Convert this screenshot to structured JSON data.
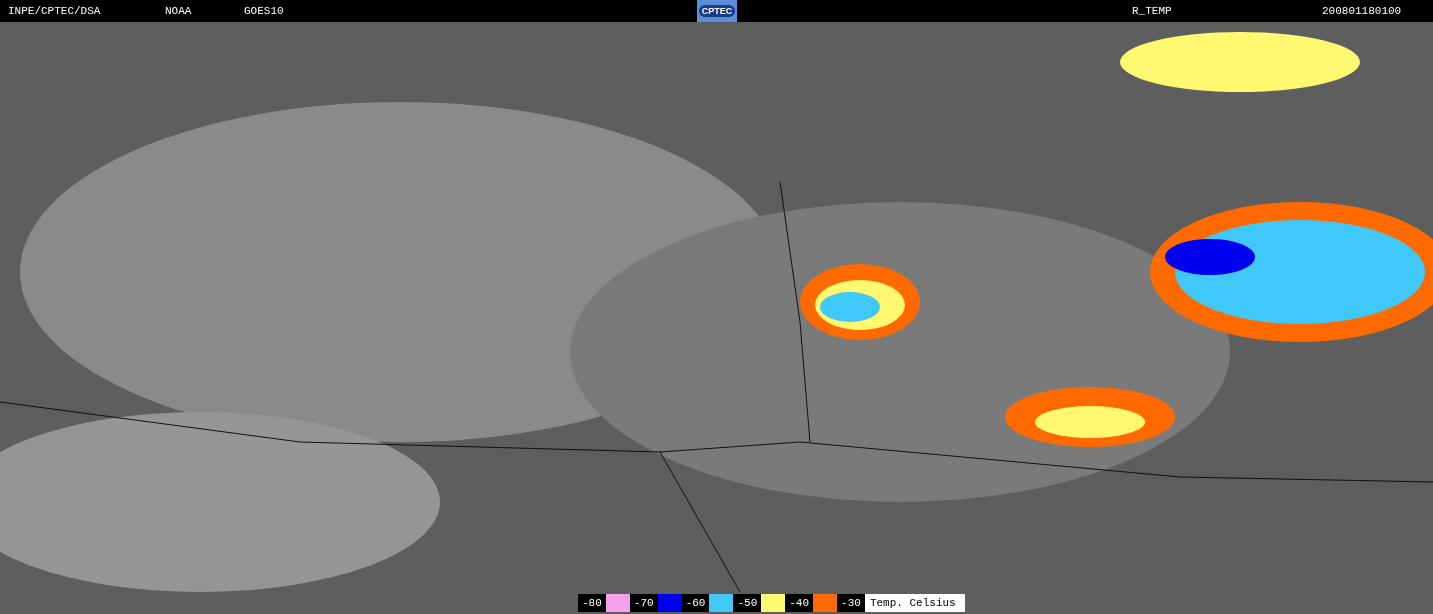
{
  "header": {
    "source": "INPE/CPTEC/DSA",
    "agency": "NOAA",
    "satellite": "GOES10",
    "logo": "CPTEC",
    "product": "R_TEMP",
    "timestamp": "200801180100"
  },
  "legend": {
    "items": [
      {
        "label": "-80",
        "color": "#f8a0f0"
      },
      {
        "label": "-70",
        "color": "#0000f0"
      },
      {
        "label": "-60",
        "color": "#40c8f8"
      },
      {
        "label": "-50",
        "color": "#fff870"
      },
      {
        "label": "-40",
        "color": "#ff6a00"
      },
      {
        "label": "-30"
      }
    ],
    "unit": "Temp. Celsius"
  }
}
